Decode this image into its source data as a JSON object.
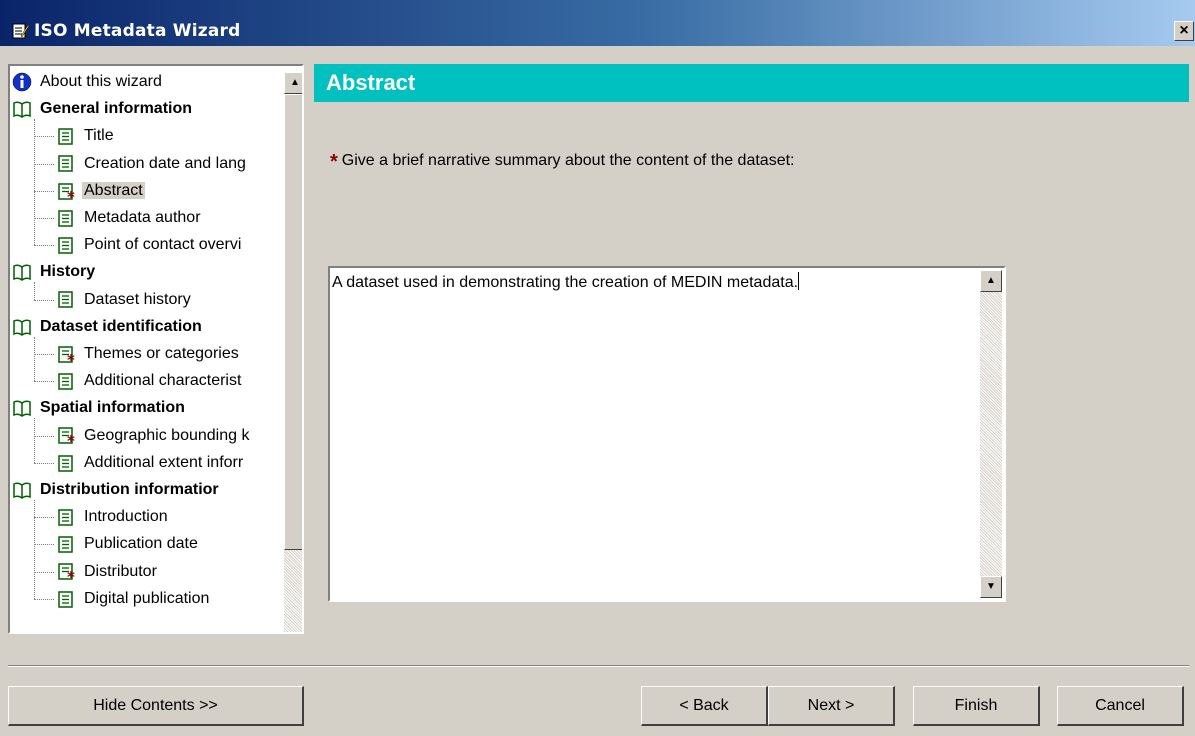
{
  "window": {
    "title": "ISO Metadata Wizard",
    "close_glyph": "×"
  },
  "tree": {
    "items": [
      {
        "label": "About this wizard",
        "kind": "info",
        "level": 0
      },
      {
        "label": "General information",
        "kind": "group",
        "level": 0
      },
      {
        "label": "Title",
        "kind": "page",
        "level": 1
      },
      {
        "label": "Creation date and lang",
        "kind": "page",
        "level": 1
      },
      {
        "label": "Abstract",
        "kind": "page-required",
        "level": 1,
        "selected": true
      },
      {
        "label": "Metadata author",
        "kind": "page",
        "level": 1
      },
      {
        "label": "Point of contact overvi",
        "kind": "page",
        "level": 1
      },
      {
        "label": "History",
        "kind": "group",
        "level": 0
      },
      {
        "label": "Dataset history",
        "kind": "page",
        "level": 1
      },
      {
        "label": "Dataset identification",
        "kind": "group",
        "level": 0
      },
      {
        "label": "Themes or categories",
        "kind": "page-required",
        "level": 1
      },
      {
        "label": "Additional characterist",
        "kind": "page",
        "level": 1
      },
      {
        "label": "Spatial information",
        "kind": "group",
        "level": 0
      },
      {
        "label": "Geographic bounding k",
        "kind": "page-required",
        "level": 1
      },
      {
        "label": "Additional extent inforr",
        "kind": "page",
        "level": 1
      },
      {
        "label": "Distribution informatior",
        "kind": "group",
        "level": 0
      },
      {
        "label": "Introduction",
        "kind": "page",
        "level": 1
      },
      {
        "label": "Publication date",
        "kind": "page",
        "level": 1
      },
      {
        "label": "Distributor",
        "kind": "page-required",
        "level": 1
      },
      {
        "label": "Digital publication",
        "kind": "page",
        "level": 1
      }
    ]
  },
  "main": {
    "header": "Abstract",
    "prompt": "Give a brief narrative summary about the content of the dataset:",
    "abstract_value": "A dataset used in demonstrating the creation of MEDIN metadata."
  },
  "buttons": {
    "hide_contents": "Hide Contents >>",
    "back": "< Back",
    "next": "Next >",
    "finish": "Finish",
    "cancel": "Cancel"
  },
  "colors": {
    "header_bg": "#00c0c0",
    "required_star": "#8b0000",
    "titlebar_start": "#0a246a"
  },
  "icons": {
    "info": "info-icon",
    "group": "book-icon",
    "page": "page-icon",
    "required": "required-star-icon"
  }
}
